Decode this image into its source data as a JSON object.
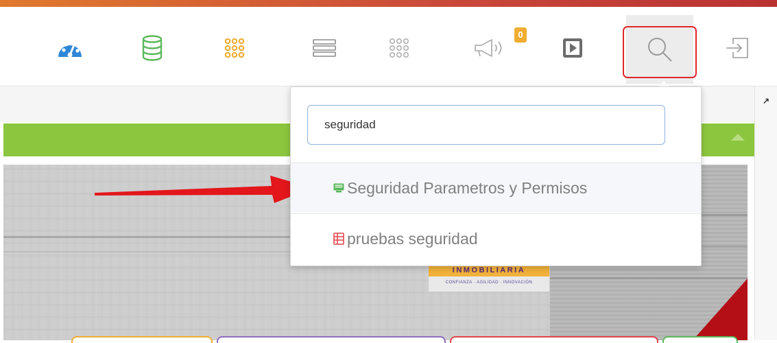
{
  "toolbar": {
    "buttons": [
      {
        "icon": "speedometer-icon",
        "color": "#2f86d6"
      },
      {
        "icon": "database-icon",
        "color": "#5cb85c"
      },
      {
        "icon": "grid-dots-icon",
        "color": "#f0ad32"
      },
      {
        "icon": "menu-lines-icon",
        "color": "#8a8a8a"
      },
      {
        "icon": "grid-dots-outline-icon",
        "color": "#b0b0b0"
      },
      {
        "icon": "megaphone-icon",
        "color": "#b0b0b0"
      },
      {
        "icon": "play-box-icon",
        "color": "#6c6c6c"
      },
      {
        "icon": "search-icon",
        "color": "#9a9a9a"
      },
      {
        "icon": "logout-icon",
        "color": "#9a9a9a"
      }
    ],
    "notification_count": "0"
  },
  "search": {
    "query": "seguridad",
    "results": [
      {
        "label": "Seguridad Parametros y Permisos",
        "icon": "monitor-icon",
        "icon_color": "#5cb85c"
      },
      {
        "label": "pruebas seguridad",
        "icon": "report-icon",
        "icon_color": "#e0454a"
      }
    ]
  },
  "banner": {
    "brand_name": "INMOBILIARIA",
    "brand_tagline": "CONFIANZA · AGILIDAD · INNOVACIÓN"
  },
  "colors": {
    "panel_header": "#8cc63f",
    "highlight_border": "#e0262a",
    "arrow": "#e3161b"
  }
}
